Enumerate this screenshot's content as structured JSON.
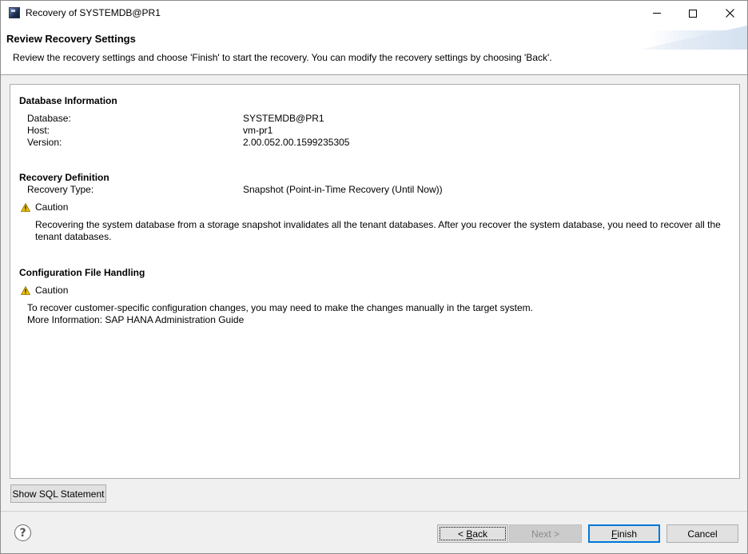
{
  "window": {
    "title": "Recovery of SYSTEMDB@PR1"
  },
  "banner": {
    "title": "Review Recovery Settings",
    "description": "Review the recovery settings and choose 'Finish' to start the recovery. You can modify the recovery settings by choosing 'Back'."
  },
  "database_info": {
    "heading": "Database Information",
    "rows": [
      {
        "label": "Database:",
        "value": "SYSTEMDB@PR1"
      },
      {
        "label": "Host:",
        "value": "vm-pr1"
      },
      {
        "label": "Version:",
        "value": "2.00.052.00.1599235305"
      }
    ]
  },
  "recovery_definition": {
    "heading": "Recovery Definition",
    "type_label": "Recovery Type:",
    "type_value": "Snapshot (Point-in-Time Recovery (Until Now))",
    "caution_label": "Caution",
    "caution_line1": "Recovering the system database from a storage snapshot invalidates all the tenant databases. After you recover the system database, you need to recover all the",
    "caution_line2": "tenant databases."
  },
  "config_file": {
    "heading": "Configuration File Handling",
    "caution_label": "Caution",
    "line1": "To recover customer-specific configuration changes, you may need to make the changes manually in the target system.",
    "line2": "More Information: SAP HANA Administration Guide"
  },
  "buttons": {
    "show_sql": "Show SQL Statement",
    "back_mnemonic": "B",
    "back_rest": "ack",
    "back_prefix": "< ",
    "next": "Next >",
    "finish_mnemonic": "F",
    "finish_rest": "inish",
    "cancel": "Cancel"
  },
  "icons": {
    "help": "?"
  },
  "colors": {
    "accent": "#0078d7",
    "warning": "#f2c200"
  }
}
